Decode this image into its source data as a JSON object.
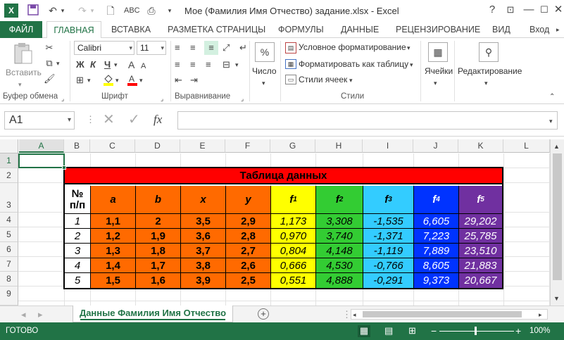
{
  "window": {
    "title": "Мое (Фамилия Имя Отчество) задание.xlsx - Excel",
    "help": "?"
  },
  "icons": {
    "app": "excel-logo",
    "save": "save-icon",
    "undo": "undo-icon",
    "redo": "redo-icon",
    "print_preview": "print-preview-icon",
    "spelling": "spelling-icon"
  },
  "ribbon_tabs": {
    "file": "ФАЙЛ",
    "home": "ГЛАВНАЯ",
    "insert": "ВСТАВКА",
    "page_layout": "РАЗМЕТКА СТРАНИЦЫ",
    "formulas": "ФОРМУЛЫ",
    "data": "ДАННЫЕ",
    "review": "РЕЦЕНЗИРОВАНИЕ",
    "view": "ВИД",
    "signin": "Вход"
  },
  "ribbon": {
    "clipboard": {
      "paste": "Вставить",
      "group": "Буфер обмена"
    },
    "font": {
      "name": "Calibri",
      "size": "11",
      "bold": "Ж",
      "italic": "К",
      "underline": "Ч",
      "grow": "A",
      "shrink": "A",
      "group": "Шрифт"
    },
    "alignment": {
      "group": "Выравнивание"
    },
    "number": {
      "label": "Число",
      "percent": "%"
    },
    "styles": {
      "conditional": "Условное форматирование",
      "as_table": "Форматировать как таблицу",
      "cell_styles": "Стили ячеек",
      "group": "Стили"
    },
    "cells": {
      "label": "Ячейки"
    },
    "editing": {
      "label": "Редактирование"
    }
  },
  "formula_bar": {
    "name_box": "A1",
    "fx": "fx",
    "value": ""
  },
  "grid": {
    "columns": [
      "A",
      "B",
      "C",
      "D",
      "E",
      "F",
      "G",
      "H",
      "I",
      "J",
      "K",
      "L"
    ],
    "rows": [
      "1",
      "2",
      "3",
      "4",
      "5",
      "6",
      "7",
      "8",
      "9"
    ],
    "selected_cell": "A1"
  },
  "table": {
    "title": "Таблица данных",
    "headers": {
      "num_line1": "№",
      "num_line2": "п/п",
      "a": "a",
      "b": "b",
      "x": "x",
      "y": "y",
      "f1": "f",
      "f1_sub": "1",
      "f2": "f",
      "f2_sub": "2",
      "f3": "f",
      "f3_sub": "3",
      "f4": "f",
      "f4_sub": "4",
      "f5": "f",
      "f5_sub": "5"
    },
    "rows": [
      [
        "1",
        "1,1",
        "2",
        "3,5",
        "2,9",
        "1,173",
        "3,308",
        "-1,535",
        "6,605",
        "29,202"
      ],
      [
        "2",
        "1,2",
        "1,9",
        "3,6",
        "2,8",
        "0,970",
        "3,740",
        "-1,371",
        "7,223",
        "25,785"
      ],
      [
        "3",
        "1,3",
        "1,8",
        "3,7",
        "2,7",
        "0,804",
        "4,148",
        "-1,119",
        "7,889",
        "23,510"
      ],
      [
        "4",
        "1,4",
        "1,7",
        "3,8",
        "2,6",
        "0,666",
        "4,530",
        "-0,766",
        "8,605",
        "21,883"
      ],
      [
        "5",
        "1,5",
        "1,6",
        "3,9",
        "2,5",
        "0,551",
        "4,888",
        "-0,291",
        "9,373",
        "20,667"
      ]
    ],
    "colors": {
      "title": "#ff0000",
      "a_to_y": "#ff6a00",
      "f1": "#ffff00",
      "f2": "#33cc33",
      "f3": "#33ccff",
      "f4": "#0033ff",
      "f5": "#7030a0"
    }
  },
  "sheet_tabs": {
    "active": "Данные Фамилия Имя Отчество",
    "add": "+"
  },
  "status": {
    "text": "ГОТОВО",
    "zoom": "100%",
    "minus": "−",
    "plus": "+"
  }
}
